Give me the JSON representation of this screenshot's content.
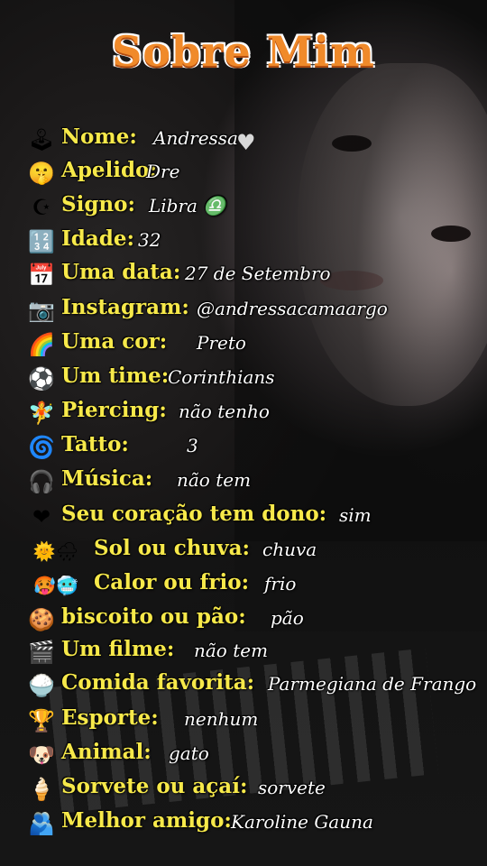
{
  "title": "Sobre Mim",
  "colors": {
    "label": "#f7e94a",
    "value": "#ffffff",
    "title": "#f08a2a"
  },
  "rows": [
    {
      "icon": "joystick-icon",
      "glyph": "🕹",
      "label": "Nome:",
      "value": "Andressa"
    },
    {
      "icon": "shushing-face-icon",
      "glyph": "🤫",
      "label": "Apelido:",
      "value": "Dre"
    },
    {
      "icon": "star-crescent-icon",
      "glyph": "☪",
      "label": "Signo:",
      "value": "Libra ♎"
    },
    {
      "icon": "numbers-icon",
      "glyph": "🔢",
      "label": "Idade:",
      "value": "32"
    },
    {
      "icon": "calendar-icon",
      "glyph": "📅",
      "label": "Uma data:",
      "value": "27 de Setembro"
    },
    {
      "icon": "camera-icon",
      "glyph": "📷",
      "label": "Instagram:",
      "value": "@andressacamaargo"
    },
    {
      "icon": "rainbow-icon",
      "glyph": "🌈",
      "label": "Uma cor:",
      "value": "Preto"
    },
    {
      "icon": "soccer-ball-icon",
      "glyph": "⚽",
      "label": "Um time:",
      "value": "Corinthians"
    },
    {
      "icon": "fairy-icon",
      "glyph": "🧚",
      "label": "Piercing:",
      "value": "não tenho"
    },
    {
      "icon": "cyclone-icon",
      "glyph": "🌀",
      "label": "Tatto:",
      "value": "3"
    },
    {
      "icon": "headphones-icon",
      "glyph": "🎧",
      "label": "Música:",
      "value": "não tem"
    },
    {
      "icon": "red-heart-icon",
      "glyph": "❤",
      "label": "Seu coração tem dono:",
      "value": "sim"
    },
    {
      "icon": "sun-rain-icon",
      "glyph": "🌞🌧",
      "label": "Sol ou chuva:",
      "value": "chuva"
    },
    {
      "icon": "hot-cold-face-icon",
      "glyph": "🥵🥶",
      "label": "Calor ou frio:",
      "value": "frio"
    },
    {
      "icon": "cookie-icon",
      "glyph": "🍪",
      "label": "biscoito ou pão:",
      "value": "pão"
    },
    {
      "icon": "clapper-board-icon",
      "glyph": "🎬",
      "label": "Um filme:",
      "value": "não tem"
    },
    {
      "icon": "rice-bowl-icon",
      "glyph": "🍚",
      "label": "Comida favorita:",
      "value": "Parmegiana de Frango"
    },
    {
      "icon": "trophy-icon",
      "glyph": "🏆",
      "label": "Esporte:",
      "value": "nenhum"
    },
    {
      "icon": "dog-face-icon",
      "glyph": "🐶",
      "label": "Animal:",
      "value": "gato"
    },
    {
      "icon": "ice-cream-icon",
      "glyph": "🍦",
      "label": "Sorvete ou açaí:",
      "value": "sorvete"
    },
    {
      "icon": "people-icon",
      "glyph": "🫂",
      "label": "Melhor amigo:",
      "value": "Karoline Gauna"
    }
  ]
}
